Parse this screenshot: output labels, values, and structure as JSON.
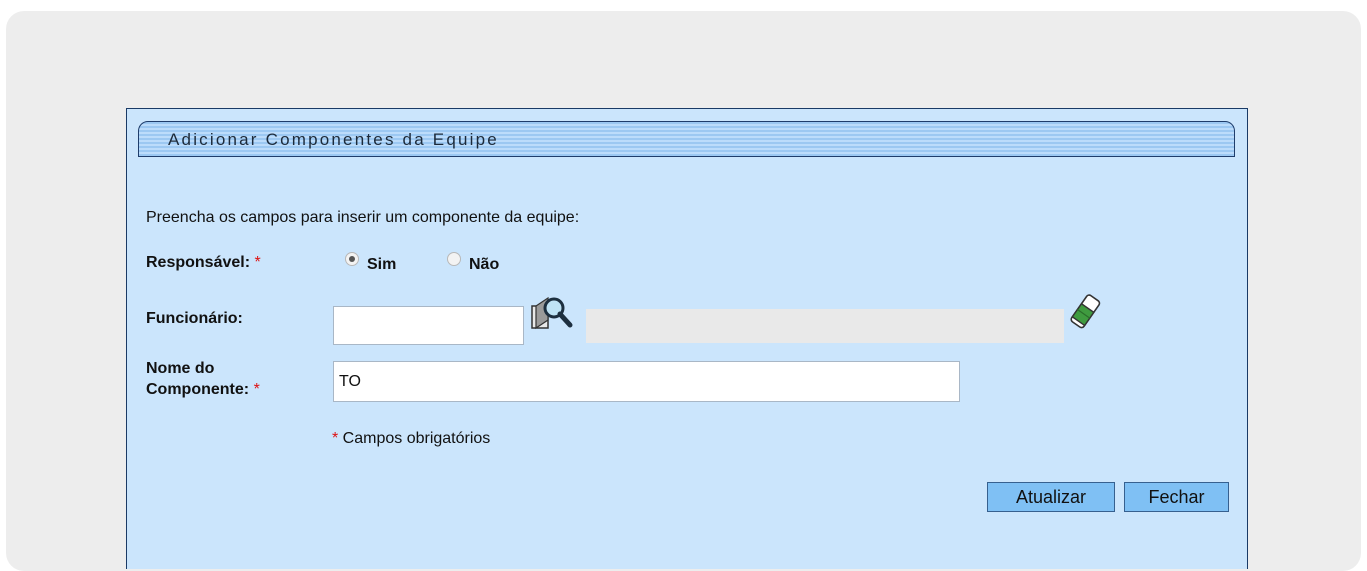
{
  "dialog": {
    "title": "Adicionar Componentes da Equipe",
    "instructions": "Preencha os campos para inserir um componente da equipe:",
    "responsavel": {
      "label": "Responsável:",
      "required_mark": "*",
      "options": [
        {
          "label": "Sim",
          "selected": true
        },
        {
          "label": "Não",
          "selected": false
        }
      ]
    },
    "funcionario": {
      "label": "Funcionário:",
      "code_value": "",
      "name_value": "",
      "search_icon": "magnifier-search-icon",
      "clear_icon": "eraser-icon"
    },
    "nome_componente": {
      "label_line1": "Nome do",
      "label_line2": "Componente:",
      "required_mark": "*",
      "value": "TO"
    },
    "required_note": {
      "mark": "*",
      "text": " Campos obrigatórios"
    },
    "buttons": {
      "update": "Atualizar",
      "close": "Fechar"
    }
  },
  "colors": {
    "panel_bg": "#cbe5fc",
    "button_bg": "#7fc0f4",
    "required": "#dd1111"
  }
}
